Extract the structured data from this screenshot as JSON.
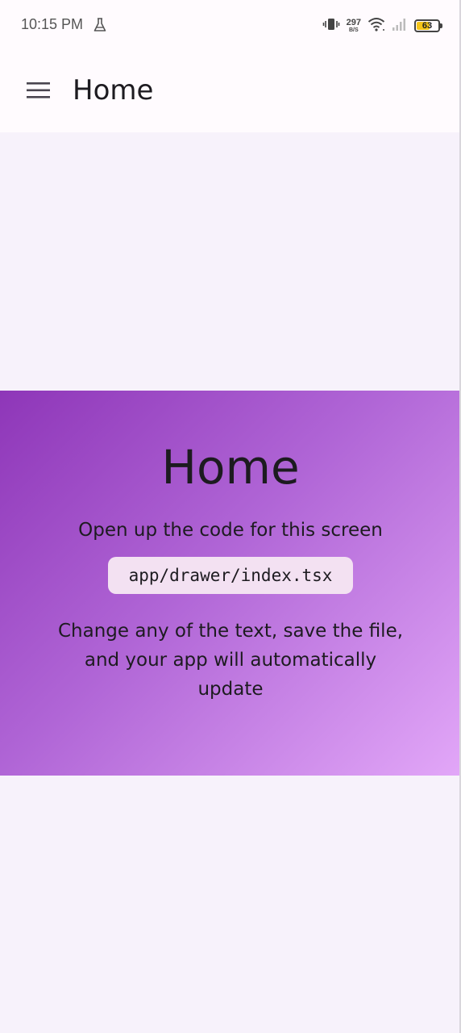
{
  "status_bar": {
    "time": "10:15 PM",
    "net_speed_value": "297",
    "net_speed_unit": "B/S",
    "battery_level": "63",
    "battery_fraction": 0.63,
    "battery_color": "#f5c518",
    "icons": [
      "flask-icon",
      "vibrate-icon",
      "wifi-icon",
      "signal-icon",
      "battery-icon"
    ]
  },
  "header": {
    "title": "Home",
    "menu_icon": "hamburger-menu-icon"
  },
  "main": {
    "title": "Home",
    "subtitle": "Open up the code for this screen",
    "code_path": "app/drawer/index.tsx",
    "body": "Change any of the text, save the file, and your app will automatically update",
    "gradient_colors": [
      "#8e36b8",
      "#b065d6",
      "#e2a7f8"
    ]
  }
}
